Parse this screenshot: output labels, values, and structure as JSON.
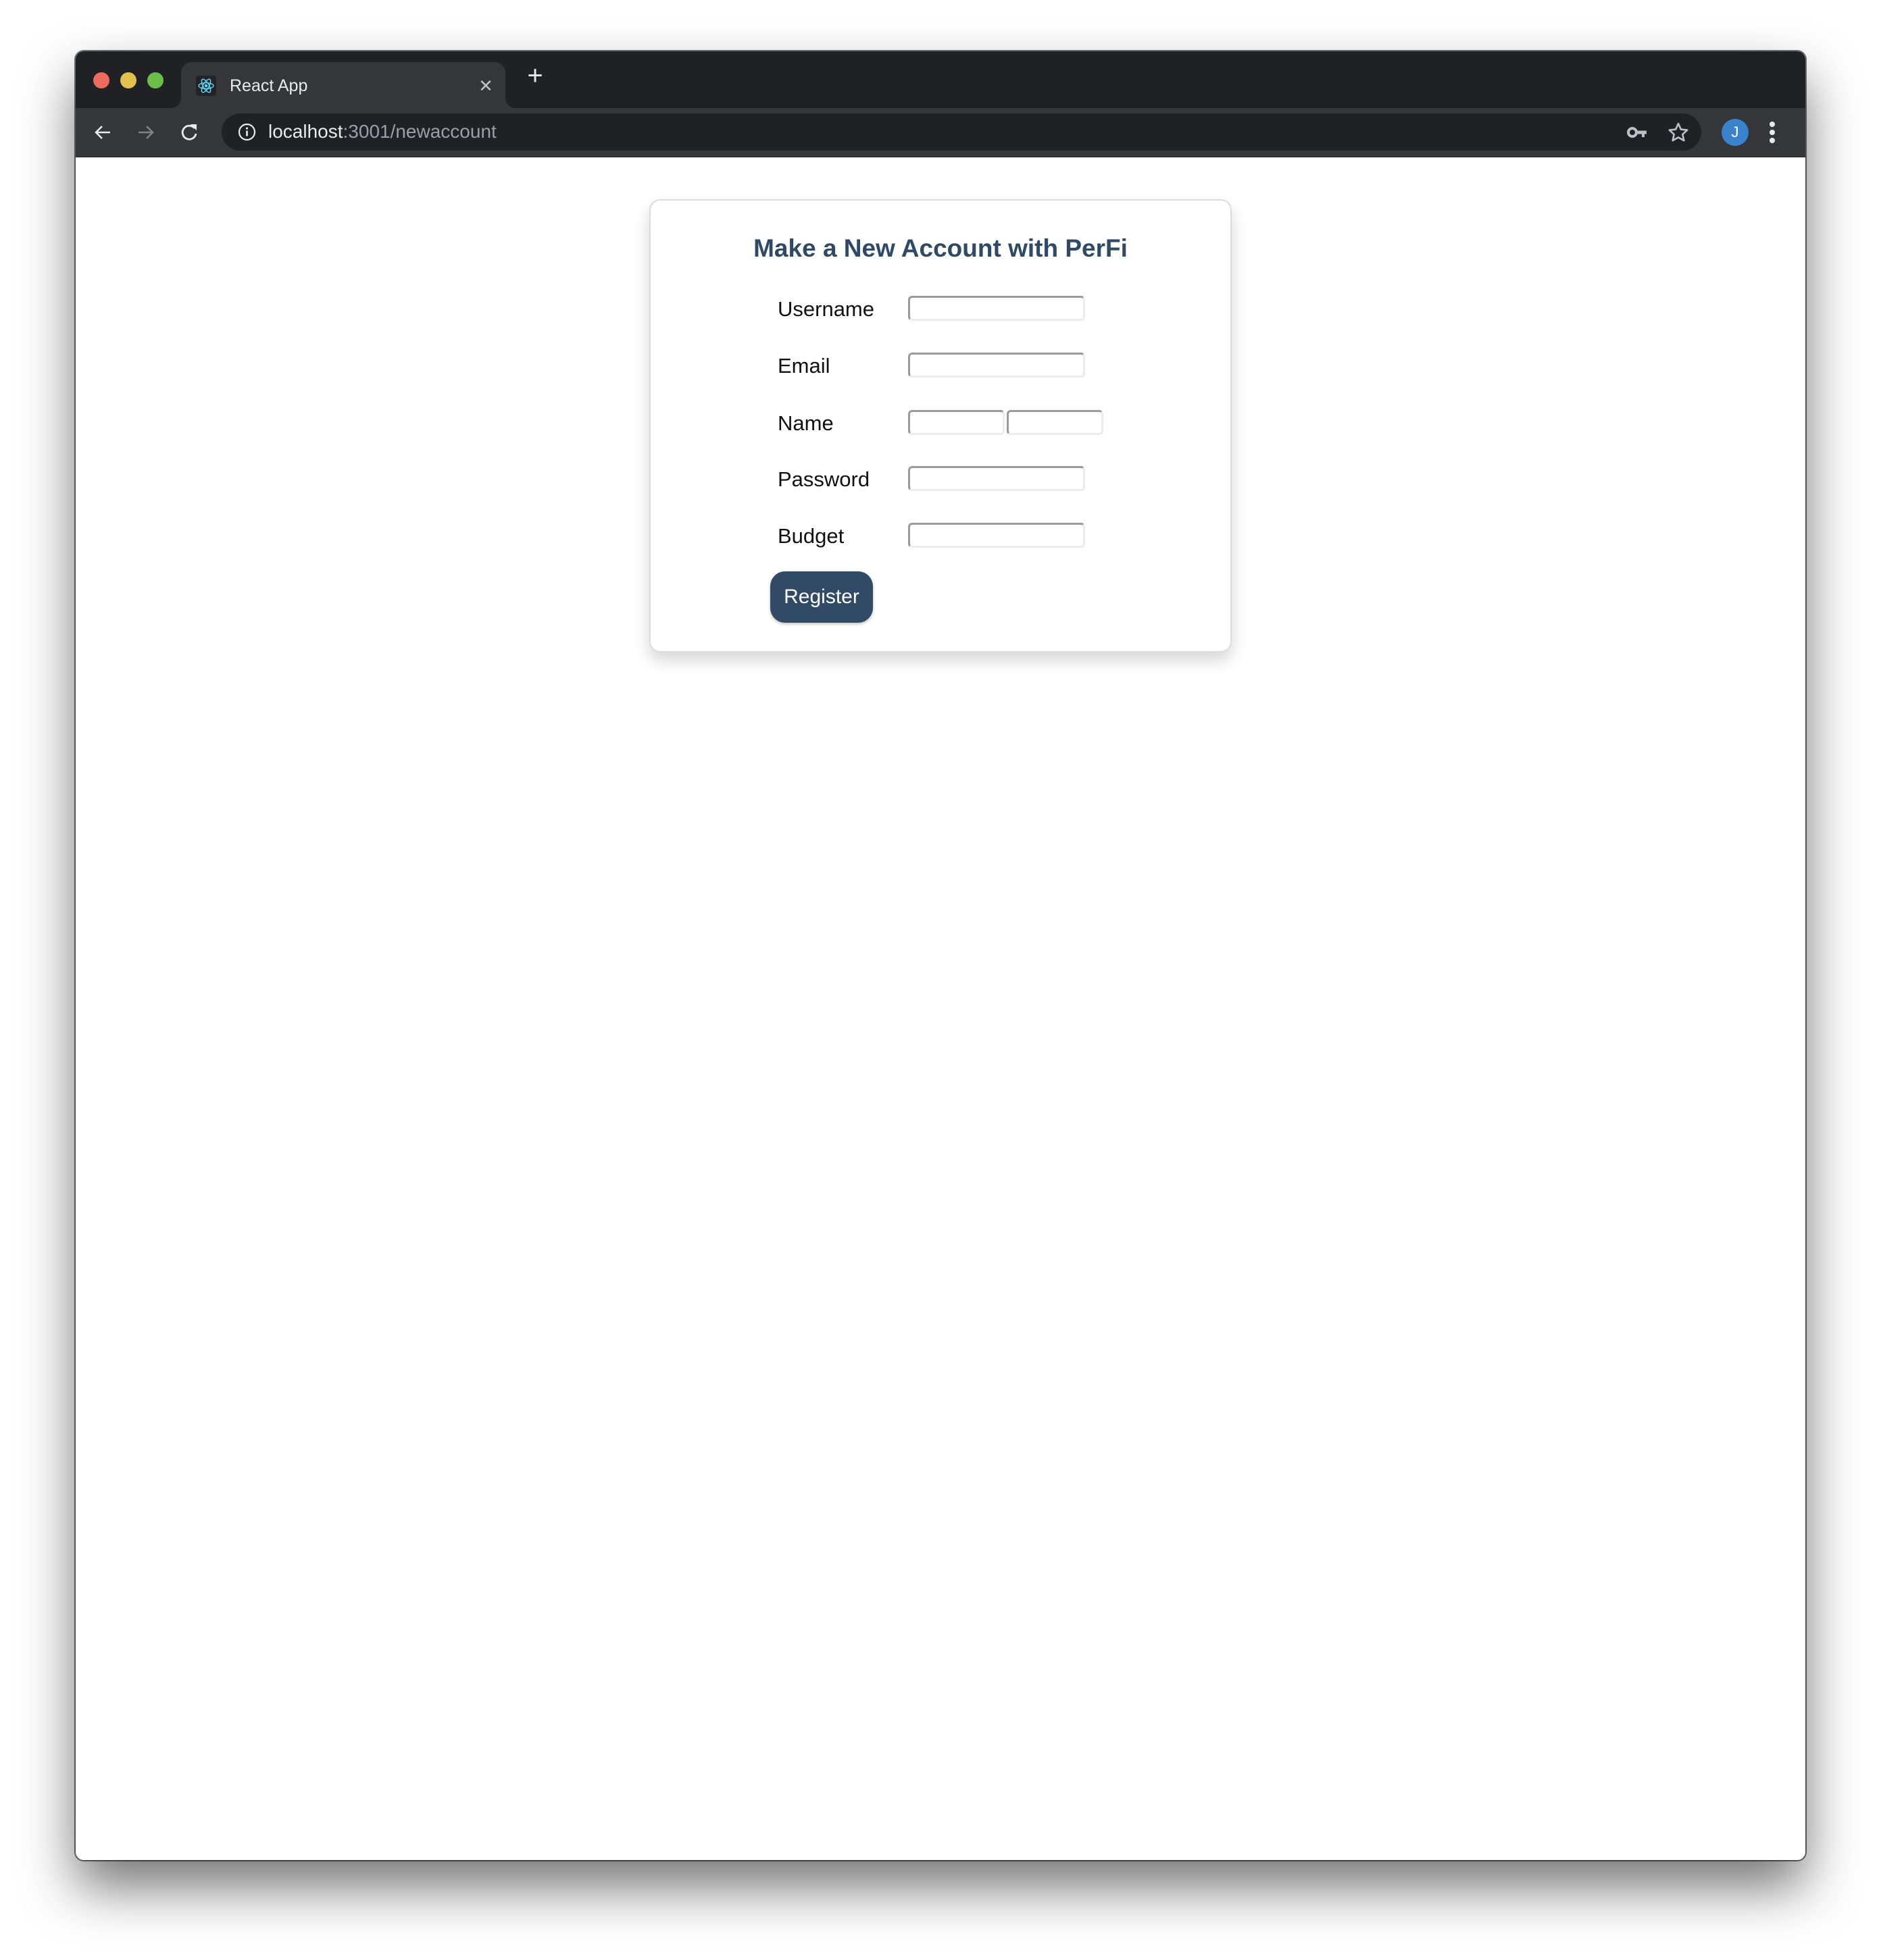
{
  "browser": {
    "tab": {
      "title": "React App",
      "favicon": "react-logo-icon",
      "close_icon": "close-icon"
    },
    "new_tab_icon": "plus-icon",
    "nav": {
      "back_icon": "arrow-left-icon",
      "forward_icon": "arrow-right-icon",
      "reload_icon": "reload-icon"
    },
    "address_bar": {
      "security_icon": "info-icon",
      "host": "localhost",
      "path": ":3001/newaccount"
    },
    "toolbar_icons": [
      "key-icon",
      "star-icon"
    ],
    "profile": {
      "initial": "J",
      "color": "#3a82cc"
    },
    "menu_icon": "kebab-menu-icon"
  },
  "page": {
    "title": "Make a New Account with PerFi",
    "title_color": "#2f4a66",
    "form": {
      "fields": [
        {
          "label": "Username",
          "value": "",
          "placeholder": ""
        },
        {
          "label": "Email",
          "value": "",
          "placeholder": ""
        },
        {
          "label": "Name",
          "first_value": "",
          "last_value": ""
        },
        {
          "label": "Password",
          "value": "",
          "placeholder": ""
        },
        {
          "label": "Budget",
          "value": "",
          "placeholder": ""
        }
      ],
      "submit_label": "Register",
      "submit_color": "#314a66"
    }
  }
}
